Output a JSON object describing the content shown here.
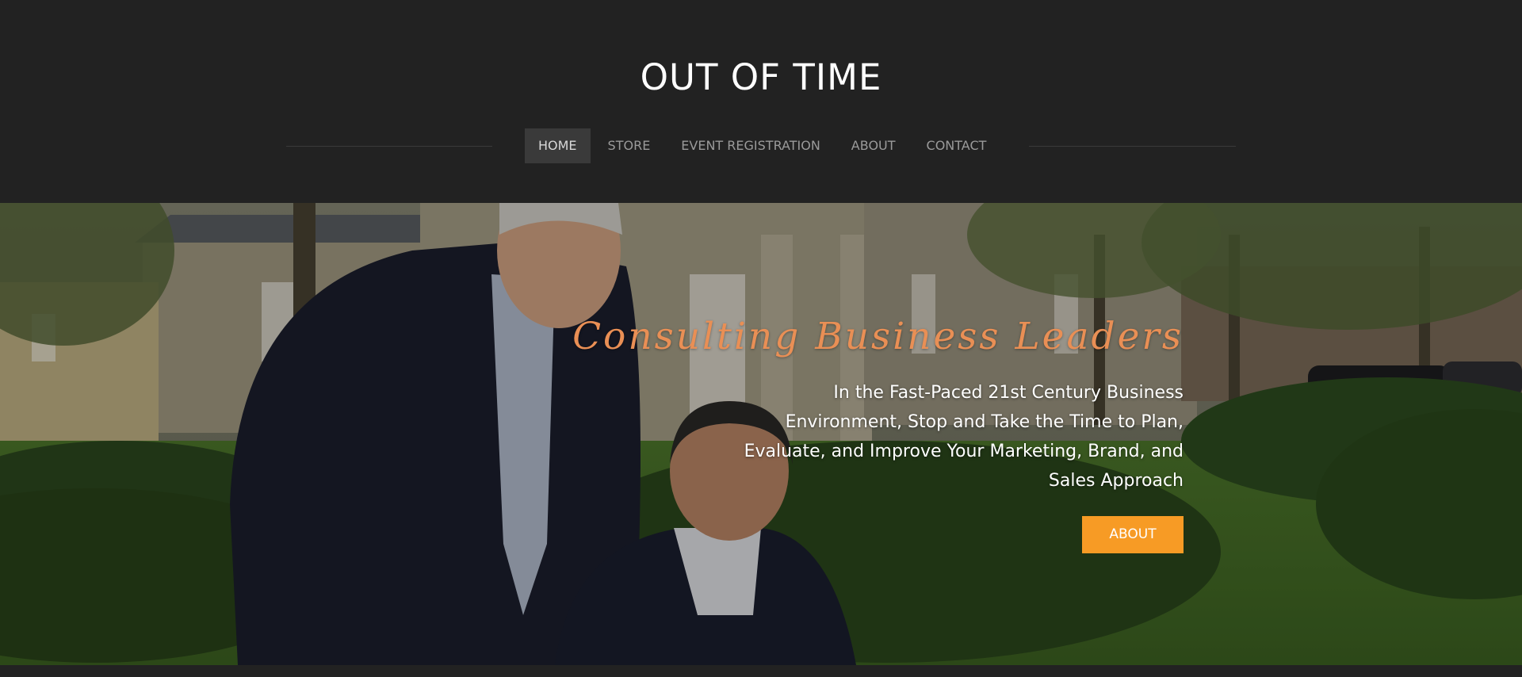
{
  "header": {
    "site_title": "OUT OF TIME",
    "nav": [
      {
        "label": "HOME",
        "active": true
      },
      {
        "label": "STORE",
        "active": false
      },
      {
        "label": "EVENT REGISTRATION",
        "active": false
      },
      {
        "label": "ABOUT",
        "active": false
      },
      {
        "label": "CONTACT",
        "active": false
      }
    ]
  },
  "hero": {
    "headline": "Consulting Business Leaders",
    "subtext_lines": [
      "In the Fast-Paced 21st Century Business",
      "Environment, Stop and Take the Time to Plan,",
      "Evaluate, and Improve Your Marketing, Brand, and",
      "Sales Approach"
    ],
    "cta_label": "ABOUT"
  },
  "colors": {
    "header_bg": "#222222",
    "headline": "#e98f55",
    "cta_bg": "#f79b25",
    "nav_text": "#9a9a9a",
    "nav_active_bg": "#3a3a3a"
  }
}
